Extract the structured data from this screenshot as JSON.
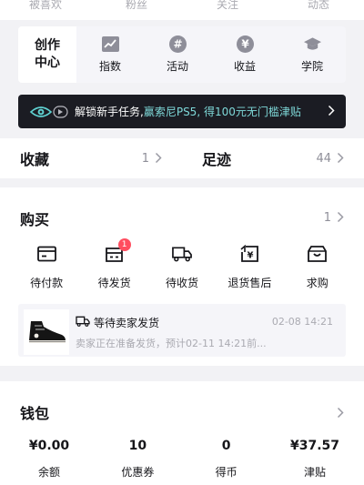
{
  "top_stats": [
    "被喜欢",
    "粉丝",
    "关注",
    "动态"
  ],
  "creator": {
    "title_line1": "创作",
    "title_line2": "中心",
    "tools": [
      {
        "label": "指数",
        "icon": "chart-icon"
      },
      {
        "label": "活动",
        "icon": "hashtag-icon"
      },
      {
        "label": "收益",
        "icon": "yen-icon"
      },
      {
        "label": "学院",
        "icon": "graduation-cap-icon"
      }
    ]
  },
  "banner": {
    "text_plain": "解锁新手任务, ",
    "text_highlight": "赢索尼PS5, 得100元无门槛津贴",
    "icon": "eye-logo-icon"
  },
  "favorites": {
    "label": "收藏",
    "count": "1"
  },
  "footprints": {
    "label": "足迹",
    "count": "44"
  },
  "purchase": {
    "title": "购买",
    "count": "1",
    "orders": [
      {
        "label": "待付款",
        "icon": "wallet-card-icon"
      },
      {
        "label": "待发货",
        "icon": "box-send-icon",
        "badge": "1"
      },
      {
        "label": "待收货",
        "icon": "truck-icon"
      },
      {
        "label": "退货售后",
        "icon": "return-yen-icon"
      },
      {
        "label": "求购",
        "icon": "shop-bag-icon"
      }
    ],
    "item": {
      "status": "等待卖家发货",
      "time": "02-08 14:21",
      "desc": "卖家正在准备发货，预计02-11 14:21前..."
    }
  },
  "wallet": {
    "title": "钱包",
    "stats": [
      {
        "value": "¥0.00",
        "label": "余额"
      },
      {
        "value": "10",
        "label": "优惠券"
      },
      {
        "value": "0",
        "label": "得币"
      },
      {
        "value": "¥37.57",
        "label": "津贴"
      }
    ]
  }
}
